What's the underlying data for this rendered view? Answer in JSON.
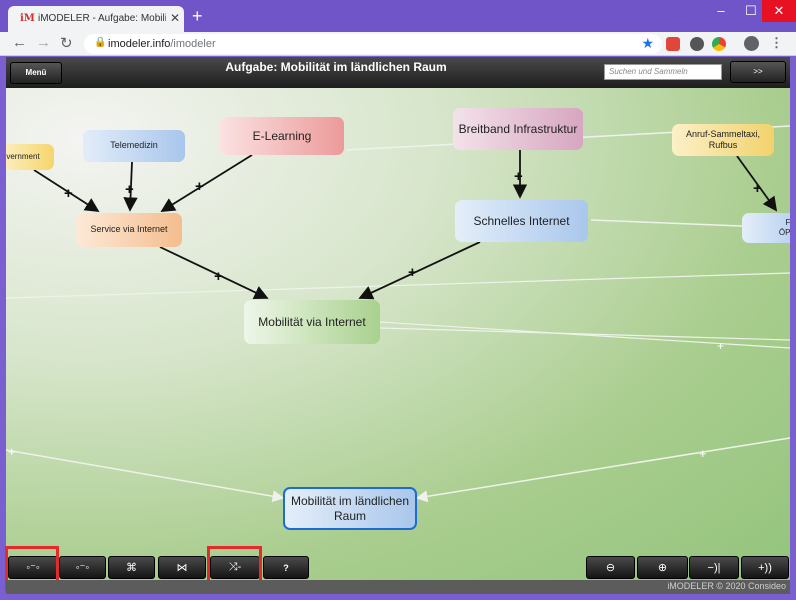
{
  "browser": {
    "tab_title": "iMODELER - Aufgabe: Mobilität i",
    "favicon": "iM",
    "url_host": "imodeler.info",
    "url_path": "/imodeler"
  },
  "app": {
    "menu_label": "Menü",
    "title": "Aufgabe: Mobilität im ländlichen Raum",
    "search_placeholder": "Suchen und Sammeln",
    "next_label": ">>"
  },
  "nodes": {
    "telemedizin": "Telemedizin",
    "elearning": "E-Learning",
    "breitband": "Breitband Infrastruktur",
    "anruf": "Anruf-Sammeltaxi, Rufbus",
    "egov": "vernment",
    "service": "Service via Internet",
    "schnelles": "Schnelles Internet",
    "flex": "Flexi ÖPNV-S",
    "mobint": "Mobilität via Internet",
    "root": "Mobilität im ländlichen Raum"
  },
  "edge_sign": "+",
  "toolbar": {
    "b1": "◦⁻◦",
    "b2": "◦⁻◦",
    "b3": "⌘",
    "b4": "⋈",
    "b5": "⤨-",
    "help": "?",
    "zoom_out": "⊖",
    "zoom_in": "⊕",
    "prev": "−)|",
    "next": "+))"
  },
  "footer": "iMODELER © 2020 Consideo",
  "colors": {
    "highlight": "#e32b2b",
    "root_border": "#1f6bd6"
  }
}
